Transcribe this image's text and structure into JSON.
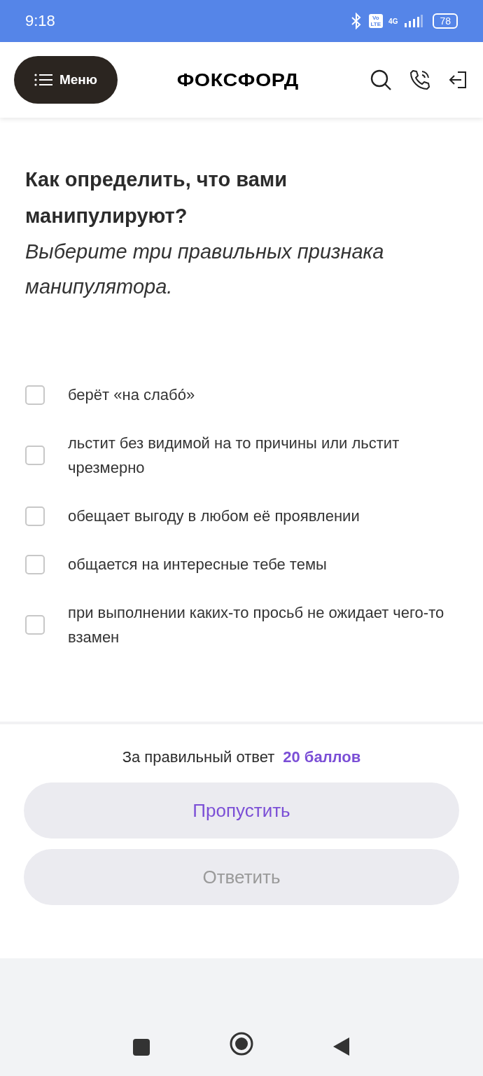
{
  "status_bar": {
    "time": "9:18",
    "volte": [
      "Vo",
      "LTE"
    ],
    "network": "4G",
    "battery": "78"
  },
  "header": {
    "menu_label": "Меню",
    "logo": "ФОКСФОРД"
  },
  "question": {
    "title": "Как определить, что вами манипулируют?",
    "hint": "Выберите три правильных признака манипулятора."
  },
  "options": [
    {
      "label": "берёт «на слабо́»",
      "checked": false
    },
    {
      "label": "льстит без видимой на то причины или льстит чрезмерно",
      "checked": false
    },
    {
      "label": "обещает выгоду в любом её проявлении",
      "checked": false
    },
    {
      "label": "общается на интересные тебе темы",
      "checked": false
    },
    {
      "label": "при выполнении каких-то просьб не ожидает чего-то взамен",
      "checked": false
    }
  ],
  "footer": {
    "reward_label": "За правильный ответ",
    "reward_points": "20 баллов",
    "buttons": [
      {
        "label": "Пропустить",
        "disabled": false
      },
      {
        "label": "Ответить",
        "disabled": true
      }
    ]
  }
}
